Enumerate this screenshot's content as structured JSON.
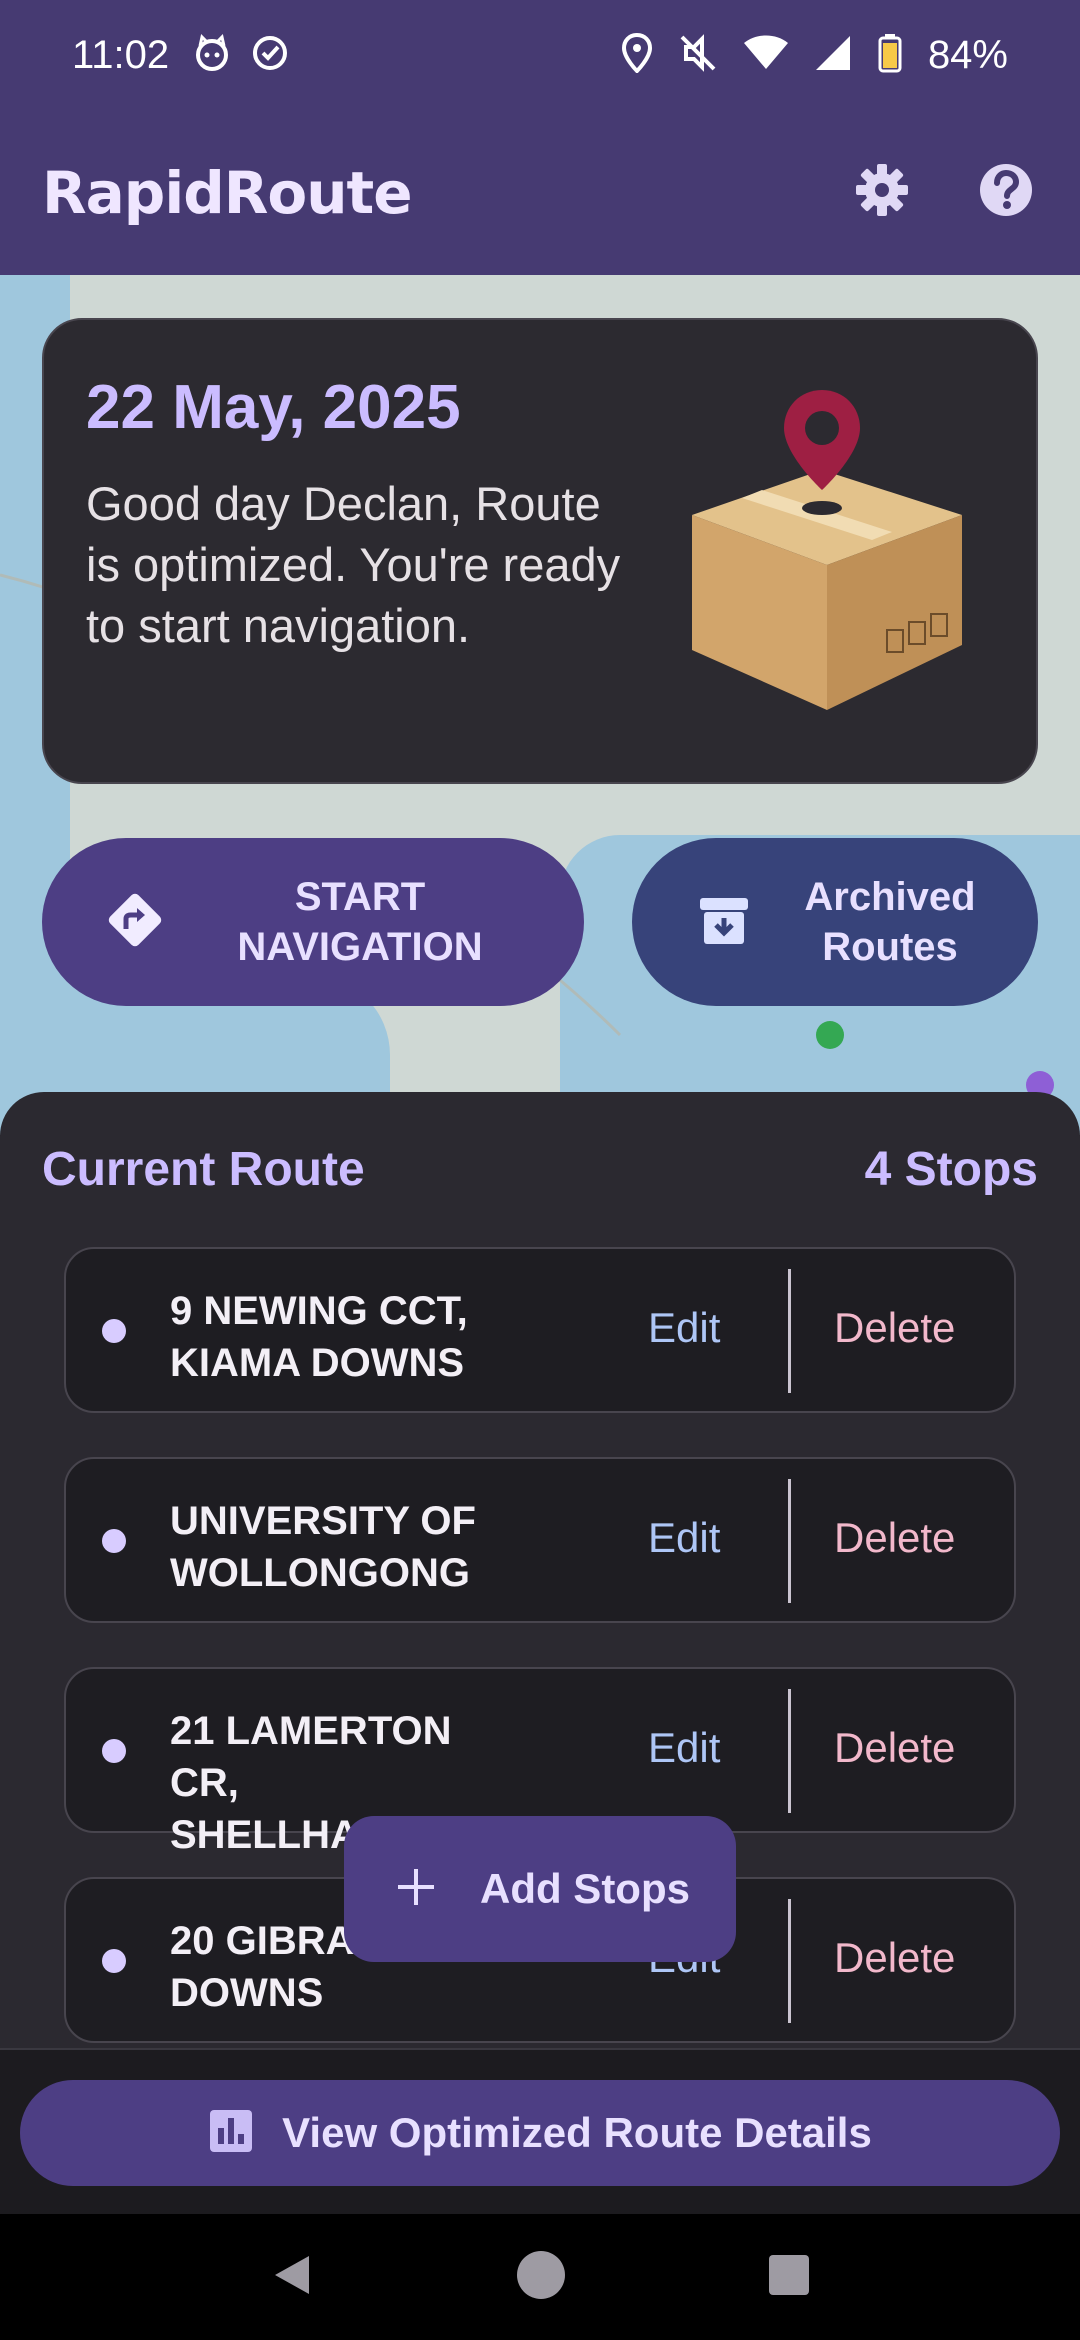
{
  "status_bar": {
    "time": "11:02",
    "battery": "84%",
    "icons": [
      "cat-face-icon",
      "check-circle-icon",
      "location-icon",
      "mute-icon",
      "wifi-icon",
      "signal-icon",
      "battery-icon"
    ]
  },
  "app_bar": {
    "title": "RapidRoute",
    "actions": [
      "gear-icon",
      "help-icon"
    ]
  },
  "summary_card": {
    "date": "22 May, 2025",
    "message": "Good day Declan, Route is optimized. You're ready to start navigation.",
    "illustration": "package-pin-illustration"
  },
  "actions": {
    "start_navigation": "START NAVIGATION",
    "archived_routes": "Archived Routes"
  },
  "route": {
    "title": "Current Route",
    "count": "4 Stops",
    "stops": [
      {
        "address": "9 NEWING CCT, KIAMA DOWNS",
        "edit": "Edit",
        "delete": "Delete"
      },
      {
        "address": "UNIVERSITY OF WOLLONGONG",
        "edit": "Edit",
        "delete": "Delete"
      },
      {
        "address": "21 LAMERTON CR, SHELLHARBOUR",
        "edit": "Edit",
        "delete": "Delete"
      },
      {
        "address": "20 GIBRA KIAMA DOWNS",
        "edit": "Edit",
        "delete": "Delete"
      }
    ]
  },
  "add_stops": "Add Stops",
  "view_details": "View Optimized Route Details",
  "colors": {
    "appbar": "#463a72",
    "accent": "#cbbcff",
    "primary_button": "#4d3e84",
    "secondary_button": "#37437a",
    "delete_text": "#f2b8cb",
    "edit_text": "#aec6f6"
  }
}
